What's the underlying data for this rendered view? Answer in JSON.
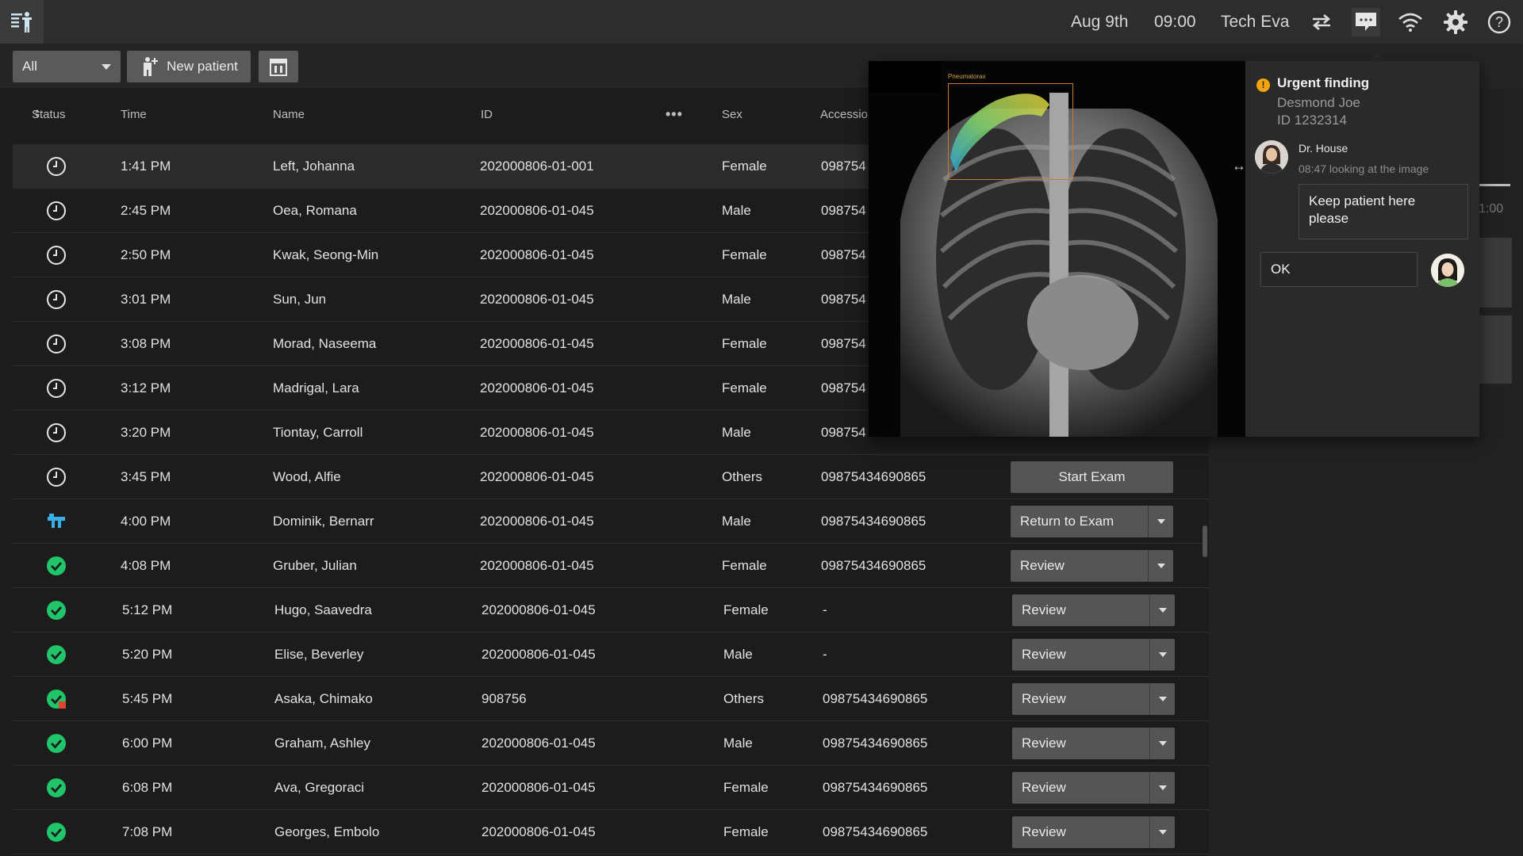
{
  "header": {
    "date": "Aug 9th",
    "time": "09:00",
    "user": "Tech Eva",
    "icons": [
      "menu-logo-icon",
      "transfer-arrows-icon",
      "chat-icon",
      "wifi-icon",
      "settings-gear-icon",
      "help-icon"
    ]
  },
  "toolbar": {
    "filter_value": "All",
    "new_patient_label": "New patient"
  },
  "table": {
    "headers": {
      "status": "Status",
      "time": "Time",
      "name": "Name",
      "id": "ID",
      "more": "•••",
      "sex": "Sex",
      "accession": "Accession"
    },
    "rows": [
      {
        "status": "scheduled",
        "time": "1:41 PM",
        "name": "Left, Johanna",
        "id": "202000806-01-001",
        "sex": "Female",
        "accession": "098754",
        "action": ""
      },
      {
        "status": "scheduled",
        "time": "2:45 PM",
        "name": "Oea, Romana",
        "id": "202000806-01-045",
        "sex": "Male",
        "accession": "098754",
        "action": ""
      },
      {
        "status": "scheduled",
        "time": "2:50 PM",
        "name": "Kwak, Seong-Min",
        "id": "202000806-01-045",
        "sex": "Female",
        "accession": "098754",
        "action": ""
      },
      {
        "status": "scheduled",
        "time": "3:01 PM",
        "name": "Sun, Jun",
        "id": "202000806-01-045",
        "sex": "Male",
        "accession": "098754",
        "action": ""
      },
      {
        "status": "scheduled",
        "time": "3:08 PM",
        "name": "Morad, Naseema",
        "id": "202000806-01-045",
        "sex": "Female",
        "accession": "098754",
        "action": ""
      },
      {
        "status": "scheduled",
        "time": "3:12 PM",
        "name": "Madrigal, Lara",
        "id": "202000806-01-045",
        "sex": "Female",
        "accession": "098754",
        "action": ""
      },
      {
        "status": "scheduled",
        "time": "3:20 PM",
        "name": "Tiontay, Carroll",
        "id": "202000806-01-045",
        "sex": "Male",
        "accession": "098754",
        "action": ""
      },
      {
        "status": "scheduled",
        "time": "3:45 PM",
        "name": "Wood, Alfie",
        "id": "202000806-01-045",
        "sex": "Others",
        "accession": "09875434690865",
        "action": "Start Exam"
      },
      {
        "status": "in-exam",
        "time": "4:00 PM",
        "name": "Dominik, Bernarr",
        "id": "202000806-01-045",
        "sex": "Male",
        "accession": "09875434690865",
        "action": "Return to Exam"
      },
      {
        "status": "done",
        "time": "4:08 PM",
        "name": "Gruber, Julian",
        "id": "202000806-01-045",
        "sex": "Female",
        "accession": "09875434690865",
        "action": "Review"
      },
      {
        "status": "done",
        "time": "5:12 PM",
        "name": "Hugo, Saavedra",
        "id": "202000806-01-045",
        "sex": "Female",
        "accession": "-",
        "action": "Review"
      },
      {
        "status": "done",
        "time": "5:20 PM",
        "name": "Elise, Beverley",
        "id": "202000806-01-045",
        "sex": "Male",
        "accession": "-",
        "action": "Review"
      },
      {
        "status": "done-flagged",
        "time": "5:45 PM",
        "name": "Asaka, Chimako",
        "id": "908756",
        "sex": "Others",
        "accession": "09875434690865",
        "action": "Review"
      },
      {
        "status": "done",
        "time": "6:00 PM",
        "name": "Graham, Ashley",
        "id": "202000806-01-045",
        "sex": "Male",
        "accession": "09875434690865",
        "action": "Review"
      },
      {
        "status": "done",
        "time": "6:08 PM",
        "name": "Ava, Gregoraci",
        "id": "202000806-01-045",
        "sex": "Female",
        "accession": "09875434690865",
        "action": "Review"
      },
      {
        "status": "done",
        "time": "7:08 PM",
        "name": "Georges, Embolo",
        "id": "202000806-01-045",
        "sex": "Female",
        "accession": "09875434690865",
        "action": "Review"
      }
    ]
  },
  "side": {
    "partial_time": "1:00"
  },
  "popup": {
    "image_label": "Pneumatorax",
    "alert_title": "Urgent finding",
    "patient_name": "Desmond Joe",
    "patient_id": "ID 1232314",
    "sender": "Dr. House",
    "sender_status": "08:47 looking at the image",
    "message": "Keep patient here please",
    "reply_value": "OK"
  },
  "colors": {
    "accent_green": "#20c56a",
    "accent_blue": "#3aaee8",
    "warning_orange": "#f2a40c",
    "flag_red": "#e2452d"
  }
}
